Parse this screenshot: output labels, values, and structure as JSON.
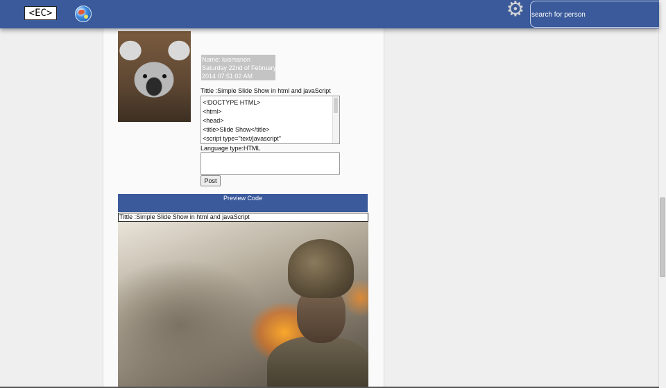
{
  "header": {
    "logo_text": "<EC>",
    "search_placeholder": "search for person",
    "icons": [
      "globe-icon",
      "gear-icon"
    ],
    "accent_color": "#3a5a9b"
  },
  "post": {
    "meta": {
      "name": "Name: luismanon",
      "date": "Saturday 22nd of February",
      "time": "2014 07:51:02 AM"
    },
    "title": "Tittle :Simple Slide Show in html and javaScript",
    "code_lines": [
      "<!DOCTYPE HTML>",
      "<html>",
      "<head>",
      "<title>Slide Show</title>",
      "<script type=\"text/javascript\""
    ],
    "language_label": "Language type:HTML",
    "post_button": "Post"
  },
  "preview": {
    "bar_label": "Preview Code",
    "title": "Tittle :Simple Slide Show in html and javaScript"
  }
}
